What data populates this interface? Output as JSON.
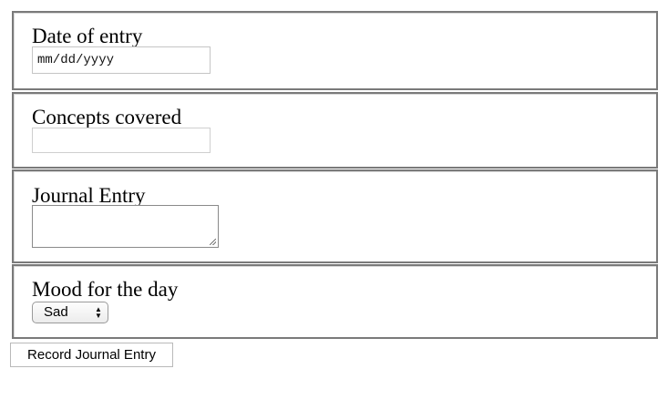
{
  "form": {
    "date_group": {
      "label": "Date of entry",
      "placeholder": "mm/dd/yyyy"
    },
    "concepts_group": {
      "label": "Concepts covered",
      "value": ""
    },
    "journal_group": {
      "label": "Journal Entry",
      "value": ""
    },
    "mood_group": {
      "label": "Mood for the day",
      "selected": "Sad"
    },
    "submit_label": "Record Journal Entry"
  },
  "icons": {
    "select_arrows": "up-down-chevron-icon",
    "resize_grip": "resize-grip-icon"
  }
}
